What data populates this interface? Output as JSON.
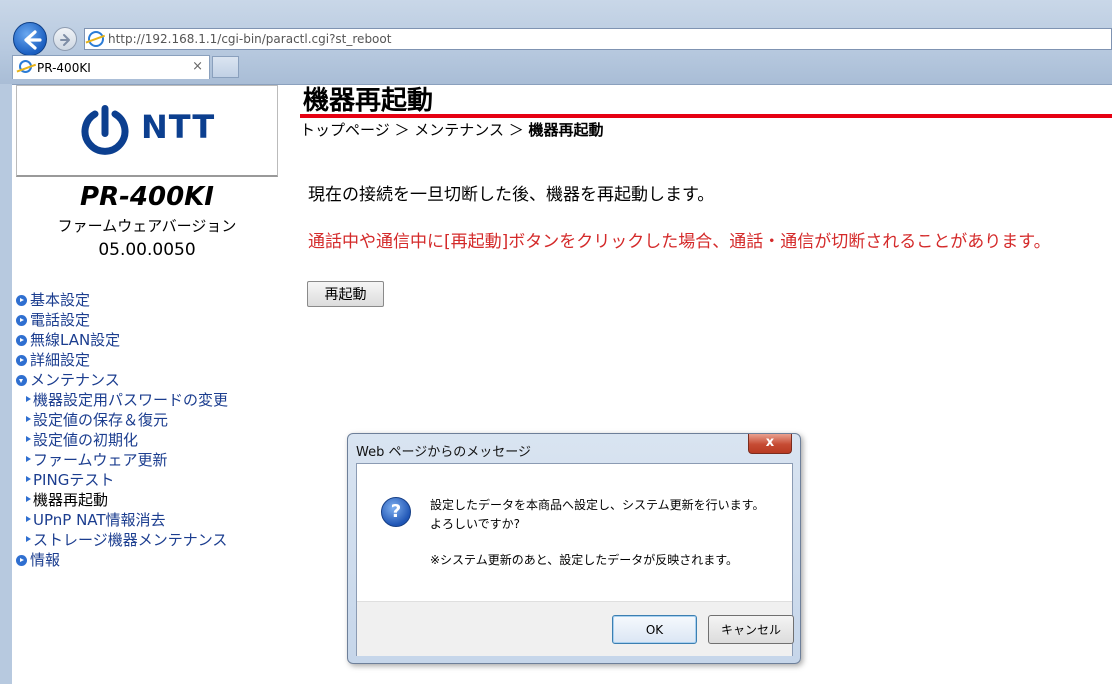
{
  "browser": {
    "url": "http://192.168.1.1/cgi-bin/paractl.cgi?st_reboot",
    "tab_title": "PR-400KI",
    "tab_close": "×"
  },
  "sidebar": {
    "logo_text": "NTT",
    "model": "PR-400KI",
    "firmware_label": "ファームウェアバージョン",
    "firmware_version": "05.00.0050",
    "menu": [
      {
        "label": "基本設定"
      },
      {
        "label": "電話設定"
      },
      {
        "label": "無線LAN設定"
      },
      {
        "label": "詳細設定"
      },
      {
        "label": "メンテナンス"
      }
    ],
    "maintenance_items": [
      {
        "label": "機器設定用パスワードの変更"
      },
      {
        "label": "設定値の保存＆復元"
      },
      {
        "label": "設定値の初期化"
      },
      {
        "label": "ファームウェア更新"
      },
      {
        "label": "PINGテスト"
      },
      {
        "label": "機器再起動"
      },
      {
        "label": "UPnP NAT情報消去"
      },
      {
        "label": "ストレージ機器メンテナンス"
      }
    ],
    "info_label": "情報"
  },
  "main": {
    "title": "機器再起動",
    "breadcrumb": {
      "top": "トップページ",
      "sep": " ＞ ",
      "maintenance": "メンテナンス",
      "current": "機器再起動"
    },
    "description": "現在の接続を一旦切断した後、機器を再起動します。",
    "warning": "通話中や通信中に[再起動]ボタンをクリックした場合、通話・通信が切断されることがあります。",
    "reboot_button": "再起動"
  },
  "dialog": {
    "title": "Web ページからのメッセージ",
    "close_label": "x",
    "icon_glyph": "?",
    "message_line1": "設定したデータを本商品へ設定し、システム更新を行います。",
    "message_line2": "よろしいですか?",
    "note": "※システム更新のあと、設定したデータが反映されます。",
    "ok": "OK",
    "cancel": "キャンセル"
  },
  "colors": {
    "accent_red": "#e60012",
    "link_blue": "#1b3d8f",
    "warning_red": "#d42a2a",
    "ntt_blue": "#0c3f8f"
  }
}
